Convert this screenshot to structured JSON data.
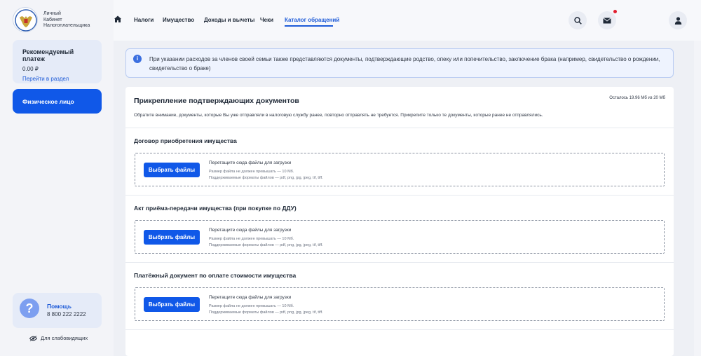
{
  "brand": {
    "line1": "Личный",
    "line2": "Кабинет",
    "line3": "Налогоплательщика"
  },
  "sidebar": {
    "recommended": {
      "title": "Рекомендуемый платеж",
      "amount": "0.00 ₽",
      "link": "Перейти в раздел"
    },
    "profile_button": "Физическое лицо",
    "help": {
      "title": "Помощь",
      "phone": "8 800 222 2222"
    },
    "accessibility": "Для слабовидящих"
  },
  "nav": {
    "items": [
      "Налоги",
      "Имущество",
      "Доходы и вычеты",
      "Чеки",
      "Каталог обращений"
    ],
    "active": "Каталог обращений"
  },
  "info_banner": {
    "text": "При указании расходов за членов своей семьи также представляются документы, подтверждающие родство, опеку или попечительство, заключение брака (например, свидетельство о рождении, свидетельство о браке)"
  },
  "upload_panel": {
    "title": "Прикрепление подтверждающих документов",
    "quota": "Осталось 19.96 Мб из 20 Мб",
    "note": "Обратите внимание, документы, которые Вы уже отправляли в налоговую службу ранее, повторно отправлять не требуется. Прикрепите только те документы, которые ранее не отправлялись.",
    "sections": [
      {
        "title": "Договор приобретения имущества",
        "button": "Выбрать файлы",
        "drop_text": "Перетащите сюда файлы для загрузки",
        "size_limit": "Размер файла не должен превышать — 10 Мб.",
        "formats": "Поддерживаемые форматы файлов — pdf, png, jpg, jpeg, tif, tiff."
      },
      {
        "title": "Акт приёма-передачи имущества (при покупке по ДДУ)",
        "button": "Выбрать файлы",
        "drop_text": "Перетащите сюда файлы для загрузки",
        "size_limit": "Размер файла не должен превышать — 10 Мб.",
        "formats": "Поддерживаемые форматы файлов — pdf, png, jpg, jpeg, tif, tiff."
      },
      {
        "title": "Платёжный документ по оплате стоимости имущества",
        "button": "Выбрать файлы",
        "drop_text": "Перетащите сюда файлы для загрузки",
        "size_limit": "Размер файла не должен превышать — 10 Мб.",
        "formats": "Поддерживаемые форматы файлов — pdf, png, jpg, jpeg, tif, tiff."
      }
    ]
  },
  "colors": {
    "accent": "#1058e8",
    "link": "#1e5bd8",
    "notification": "#e11d2e",
    "info_bg": "#eef3fe"
  },
  "icons": [
    "emblem-icon",
    "home-icon",
    "search-icon",
    "mail-icon",
    "user-icon",
    "info-icon",
    "help-icon",
    "eye-icon"
  ]
}
